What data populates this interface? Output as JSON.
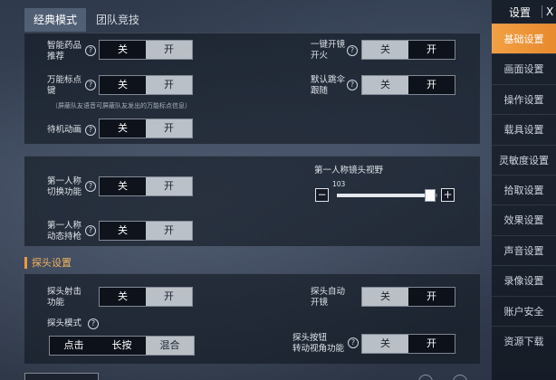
{
  "tabs": [
    {
      "label": "经典模式",
      "active": true
    },
    {
      "label": "团队竞技",
      "active": false
    }
  ],
  "toggle_labels": {
    "off": "关",
    "on": "开"
  },
  "panel1": {
    "smart_med": {
      "label1": "智能药品",
      "label2": "推荐",
      "state": "on"
    },
    "marker": {
      "label1": "万能标点",
      "label2": "键",
      "state": "on"
    },
    "marker_note": "（屏蔽队友语音可屏蔽队友发出的万能标点信息）",
    "idle_anim": {
      "label": "待机动画",
      "state": "on"
    },
    "scope_fire": {
      "label1": "一键开镜",
      "label2": "开火",
      "state": "off"
    },
    "default_jump": {
      "label1": "默认跳伞",
      "label2": "跟随",
      "state": "off"
    }
  },
  "panel2": {
    "fpp_switch": {
      "label1": "第一人称",
      "label2": "切换功能",
      "state": "on"
    },
    "fpp_dynamic": {
      "label1": "第一人称",
      "label2": "动态持枪",
      "state": "on"
    },
    "fov": {
      "label": "第一人称镜头视野",
      "value": "103",
      "fraction": 0.93,
      "minus": "−",
      "plus": "+"
    }
  },
  "section_title": "探头设置",
  "panel3": {
    "peek_shoot": {
      "label1": "探头射击",
      "label2": "功能",
      "state": "on"
    },
    "peek_auto_scope": {
      "label1": "探头自动",
      "label2": "开镜",
      "state": "off"
    },
    "peek_mode": {
      "label": "探头模式",
      "options": [
        "点击",
        "长按",
        "混合"
      ],
      "selected": 2
    },
    "peek_button": {
      "label1": "探头按钮",
      "label2": "转动视角功能",
      "state": "off"
    }
  },
  "sidebar": {
    "title": "设置",
    "close": "X",
    "items": [
      {
        "label": "基础设置",
        "active": true
      },
      {
        "label": "画面设置",
        "active": false
      },
      {
        "label": "操作设置",
        "active": false
      },
      {
        "label": "载具设置",
        "active": false
      },
      {
        "label": "灵敏度设置",
        "active": false
      },
      {
        "label": "拾取设置",
        "active": false
      },
      {
        "label": "效果设置",
        "active": false
      },
      {
        "label": "声音设置",
        "active": false
      },
      {
        "label": "录像设置",
        "active": false
      },
      {
        "label": "账户安全",
        "active": false
      },
      {
        "label": "资源下载",
        "active": false
      }
    ]
  }
}
